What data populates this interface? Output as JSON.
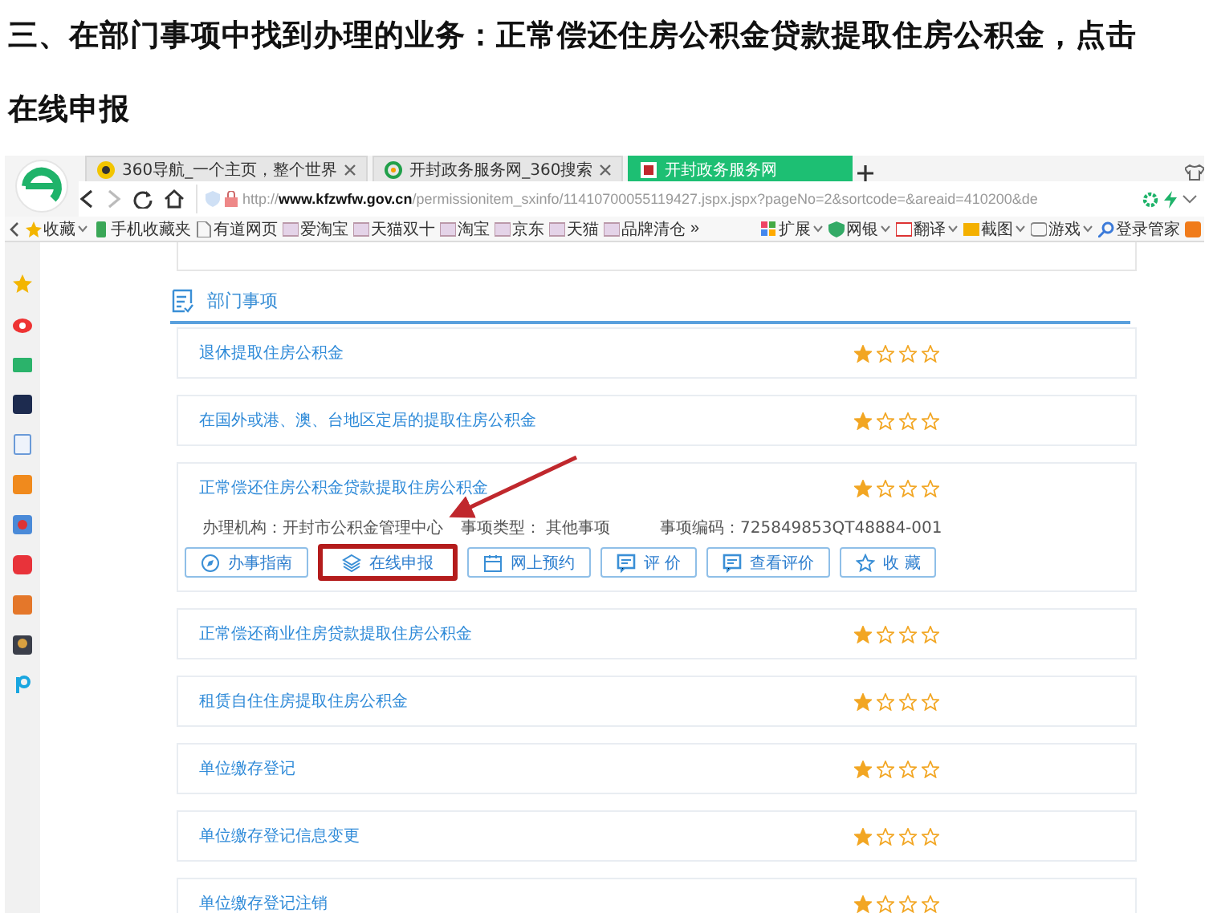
{
  "heading": "三、在部门事项中找到办理的业务：正常偿还住房公积金贷款提取住房公积金，点击在线申报",
  "browser": {
    "tabs": [
      {
        "label": "360导航_一个主页，整个世界",
        "selected": false
      },
      {
        "label": "开封政务服务网_360搜索",
        "selected": false
      },
      {
        "label": "开封政务服务网",
        "selected": true
      }
    ],
    "url": "http://**www.kfzwfw.gov.cn**/permissionitem_sxinfo/11410700055119427.jspx.jspx?pageNo=2&sortcode=&areaid=410200&de",
    "bookmarks": [
      {
        "label": "收藏",
        "dropdown": true
      },
      {
        "label": "手机收藏夹",
        "dropdown": false
      },
      {
        "label": "有道网页",
        "dropdown": false
      },
      {
        "label": "爱淘宝",
        "dropdown": false
      },
      {
        "label": "天猫双十",
        "dropdown": false
      },
      {
        "label": "淘宝",
        "dropdown": false
      },
      {
        "label": "京东",
        "dropdown": false
      },
      {
        "label": "天猫",
        "dropdown": false
      },
      {
        "label": "品牌清仓",
        "dropdown": false
      }
    ],
    "more": "»",
    "tools": [
      {
        "label": "扩展",
        "dropdown": true
      },
      {
        "label": "网银",
        "dropdown": true
      },
      {
        "label": "翻译",
        "dropdown": true
      },
      {
        "label": "截图",
        "dropdown": true
      },
      {
        "label": "游戏",
        "dropdown": true
      },
      {
        "label": "登录管家",
        "dropdown": false
      }
    ]
  },
  "section": {
    "title": "部门事项",
    "items": [
      {
        "title": "退休提取住房公积金",
        "stars": 1
      },
      {
        "title": "在国外或港、澳、台地区定居的提取住房公积金",
        "stars": 1
      },
      {
        "title": "正常偿还住房公积金贷款提取住房公积金",
        "stars": 1,
        "details": [
          "办理机构：开封市公积金管理中心",
          "事项类型： 其他事项",
          "事项编码：725849853QT48884-001"
        ],
        "actions": [
          {
            "label": "办事指南",
            "highlighted": false
          },
          {
            "label": "在线申报",
            "highlighted": true
          },
          {
            "label": "网上预约",
            "highlighted": false
          },
          {
            "label": "评 价",
            "highlighted": false
          },
          {
            "label": "查看评价",
            "highlighted": false
          },
          {
            "label": "收 藏",
            "highlighted": false
          }
        ]
      },
      {
        "title": "正常偿还商业住房贷款提取住房公积金",
        "stars": 1
      },
      {
        "title": "租赁自住住房提取住房公积金",
        "stars": 1
      },
      {
        "title": "单位缴存登记",
        "stars": 1
      },
      {
        "title": "单位缴存登记信息变更",
        "stars": 1
      },
      {
        "title": "单位缴存登记注销",
        "stars": 1
      }
    ]
  }
}
